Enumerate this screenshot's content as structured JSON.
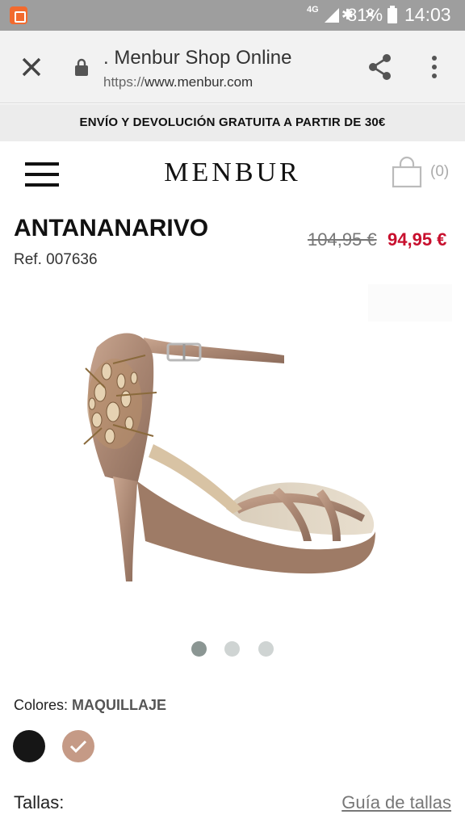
{
  "status_bar": {
    "network": "4G",
    "battery": "81%",
    "time": "14:03"
  },
  "browser": {
    "page_title": ". Menbur Shop Online",
    "url_scheme": "https://",
    "url_host": "www.menbur.com"
  },
  "promo_banner": "ENVÍO Y DEVOLUCIÓN GRATUITA A PARTIR DE 30€",
  "header": {
    "logo": "MENBUR",
    "cart_count": "(0)"
  },
  "product": {
    "name": "ANTANANARIVO",
    "ref": "Ref. 007636",
    "price_old": "104,95 €",
    "price_new": "94,95 €",
    "image_count": 3,
    "active_image": 1
  },
  "colors": {
    "label": "Colores:",
    "selected": "MAQUILLAJE",
    "swatches": [
      "#161616",
      "#c59a86"
    ]
  },
  "sizes": {
    "label": "Tallas:",
    "guide_link": "Guía de tallas"
  },
  "theme": {
    "price_color": "#c8102e",
    "status_bar_color": "#9e9e9e"
  }
}
